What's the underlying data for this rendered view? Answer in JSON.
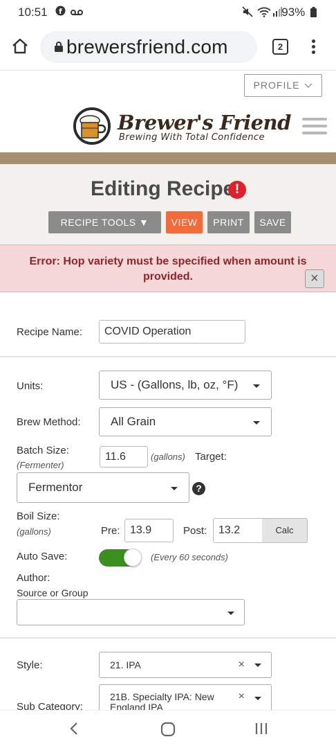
{
  "status_bar": {
    "time": "10:51",
    "battery": "93%"
  },
  "browser": {
    "url": "brewersfriend.com",
    "tab_count": "2"
  },
  "site": {
    "profile_label": "PROFILE",
    "logo_name": "Brewer's Friend",
    "logo_tagline": "Brewing With Total Confidence"
  },
  "editor": {
    "title": "Editing Recipe",
    "error_icon": "!",
    "buttons": {
      "tools": "RECIPE TOOLS ▼",
      "view": "VIEW",
      "print": "PRINT",
      "save": "SAVE"
    }
  },
  "error": {
    "message": "Error: Hop variety must be specified when amount is provided.",
    "close": "×"
  },
  "form": {
    "recipe_name_label": "Recipe Name:",
    "recipe_name_value": "COVID Operation",
    "units_label": "Units:",
    "units_value": "US - (Gallons, lb, oz, °F)",
    "brew_method_label": "Brew Method:",
    "brew_method_value": "All Grain",
    "batch_size_label": "Batch Size:",
    "batch_size_sub": "(Fermenter)",
    "batch_size_value": "11.6",
    "batch_unit": "(gallons)",
    "target_label": "Target:",
    "target_value": "Fermentor",
    "help_icon": "?",
    "boil_size_label": "Boil Size:",
    "boil_size_sub": "(gallons)",
    "pre_label": "Pre:",
    "pre_value": "13.9",
    "post_label": "Post:",
    "post_value": "13.2",
    "calc_label": "Calc",
    "auto_save_label": "Auto Save:",
    "auto_save_on": true,
    "auto_save_note": "(Every 60 seconds)",
    "author_label": "Author:",
    "source_label": "Source or Group",
    "source_value": "",
    "style_label": "Style:",
    "style_value": "21. IPA",
    "subcat_label": "Sub Category:",
    "subcat_value_line1": "21B. Specialty IPA: New",
    "subcat_value_line2": "England IPA"
  },
  "colors": {
    "brand_brown": "#a68f70",
    "view_orange": "#f26b3a",
    "button_gray": "#8b8b8b",
    "error_bg": "#f7d8d9",
    "error_text": "#922429",
    "toggle_green": "#3a8f1f"
  }
}
